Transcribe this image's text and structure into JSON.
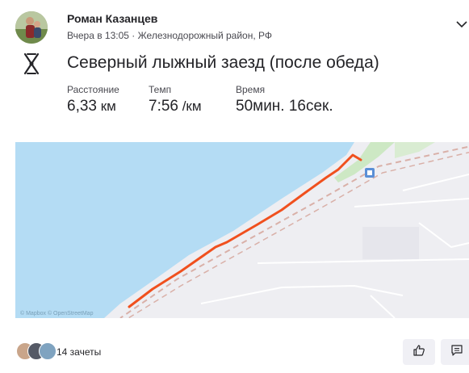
{
  "header": {
    "athlete_name": "Роман Казанцев",
    "activity_meta": "Вчера в 13:05 · Железнодорожный район, РФ",
    "avatar_icon": "user-photo",
    "menu_icon": "chevron-down-icon"
  },
  "activity": {
    "sport_icon": "nordic-ski-icon",
    "title": "Северный лыжный заезд (после обеда)",
    "stats": [
      {
        "label": "Расстояние",
        "value": "6,33",
        "unit": " км"
      },
      {
        "label": "Темп",
        "value": "7:56",
        "unit": " /км"
      },
      {
        "label": "Время",
        "value": "50мин. 16сек.",
        "unit": ""
      }
    ]
  },
  "map": {
    "attribution": "© Mapbox © OpenStreetMap",
    "colors": {
      "water": "#b4dcf4",
      "land": "#eeeef2",
      "green": "#cde8c4",
      "route": "#f0501e",
      "rail": "#d9b0a8"
    }
  },
  "footer": {
    "kudos_text": "14 зачеты",
    "kudos_icon": "thumbs-up-icon",
    "comment_icon": "comment-icon"
  }
}
